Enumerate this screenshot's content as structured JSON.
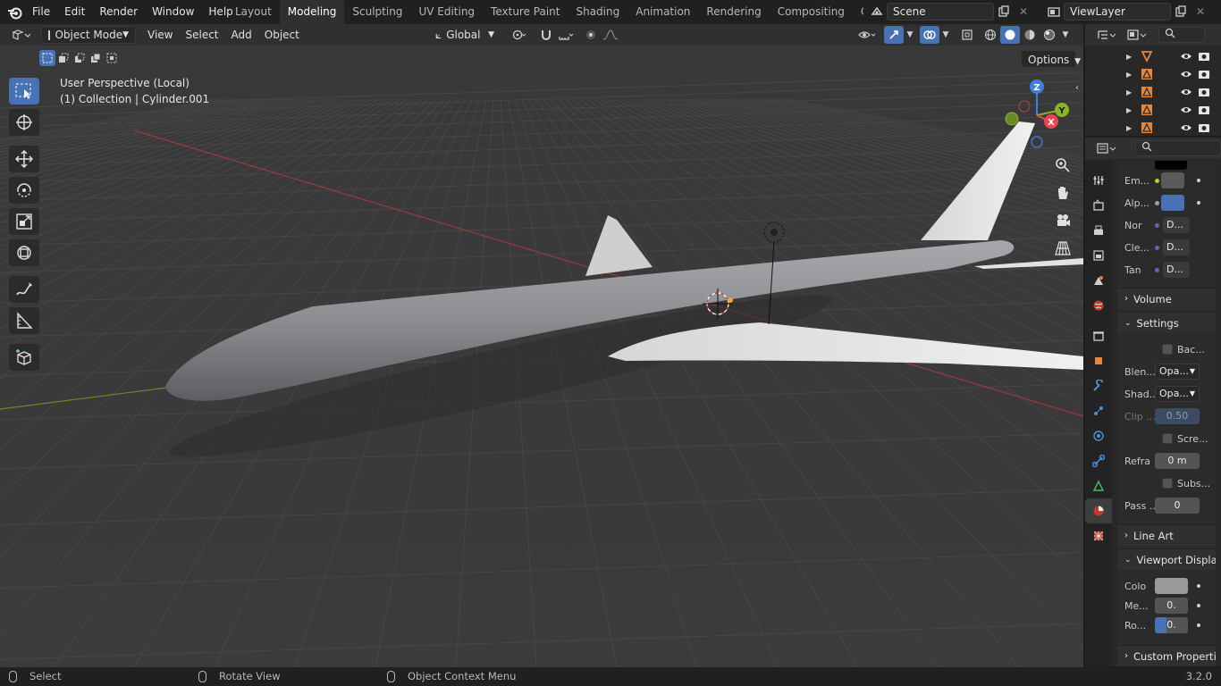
{
  "topbar": {
    "menus": [
      "File",
      "Edit",
      "Render",
      "Window",
      "Help"
    ],
    "workspaces": [
      "Layout",
      "Modeling",
      "Sculpting",
      "UV Editing",
      "Texture Paint",
      "Shading",
      "Animation",
      "Rendering",
      "Compositing",
      "Geometry Noc"
    ],
    "active_workspace": "Modeling",
    "scene_name": "Scene",
    "viewlayer_name": "ViewLayer"
  },
  "viewport_header": {
    "mode": "Object Mode",
    "menus": [
      "View",
      "Select",
      "Add",
      "Object"
    ],
    "orientation": "Global",
    "options_label": "Options"
  },
  "viewport": {
    "perspective_label": "User Perspective (Local)",
    "collection_label": "(1) Collection | Cylinder.001",
    "gizmo_axes": [
      "Z",
      "Y",
      "X"
    ],
    "colors": {
      "x_axis": "#f0424f",
      "y_axis": "#8bb324",
      "z_axis": "#3d80e0",
      "grid_line": "#444444",
      "bg": "#3a3a3a"
    }
  },
  "toolbar": {
    "tools": [
      "select-box-icon",
      "cursor-icon",
      "move-icon",
      "rotate-icon",
      "scale-icon",
      "transform-icon",
      "annotate-icon",
      "measure-icon",
      "add-cube-icon"
    ]
  },
  "outliner": {
    "rows": [
      {
        "icon": "object-data-icon"
      },
      {
        "icon": "mesh-icon"
      },
      {
        "icon": "mesh-icon"
      },
      {
        "icon": "mesh-icon"
      },
      {
        "icon": "mesh-icon"
      }
    ]
  },
  "properties": {
    "rows": [
      {
        "label": "Em...",
        "value": ""
      },
      {
        "label": "Alp...",
        "value": ""
      },
      {
        "label": "Nor",
        "value": "D..."
      },
      {
        "label": "Cle...",
        "value": "D..."
      },
      {
        "label": "Tan",
        "value": "D..."
      }
    ],
    "sections": {
      "volume": "Volume",
      "settings": "Settings",
      "line_art": "Line Art",
      "viewport_display": "Viewport Display",
      "custom_props": "Custom Properties"
    },
    "settings": {
      "backface_label": "Bac...",
      "blend_label": "Blen...",
      "blend_value": "Opa...",
      "shadow_label": "Shad...",
      "shadow_value": "Opa...",
      "clip_label": "Clip ...",
      "clip_value": "0.50",
      "screen_label": "Scre...",
      "refraction_label": "Refra",
      "refraction_value": "0 m",
      "subsurface_label": "Subs...",
      "pass_label": "Pass ...",
      "pass_value": "0"
    },
    "viewport_display": {
      "color_label": "Colo",
      "metallic_label": "Me...",
      "metallic_value": "0.",
      "roughness_label": "Ro...",
      "roughness_value": "0."
    },
    "colors": {
      "emission": "#5a5a5a",
      "alpha": "#4772b3",
      "viewport_color": "#9a9a9a"
    }
  },
  "statusbar": {
    "select": "Select",
    "rotate": "Rotate View",
    "context": "Object Context Menu",
    "version": "3.2.0"
  }
}
